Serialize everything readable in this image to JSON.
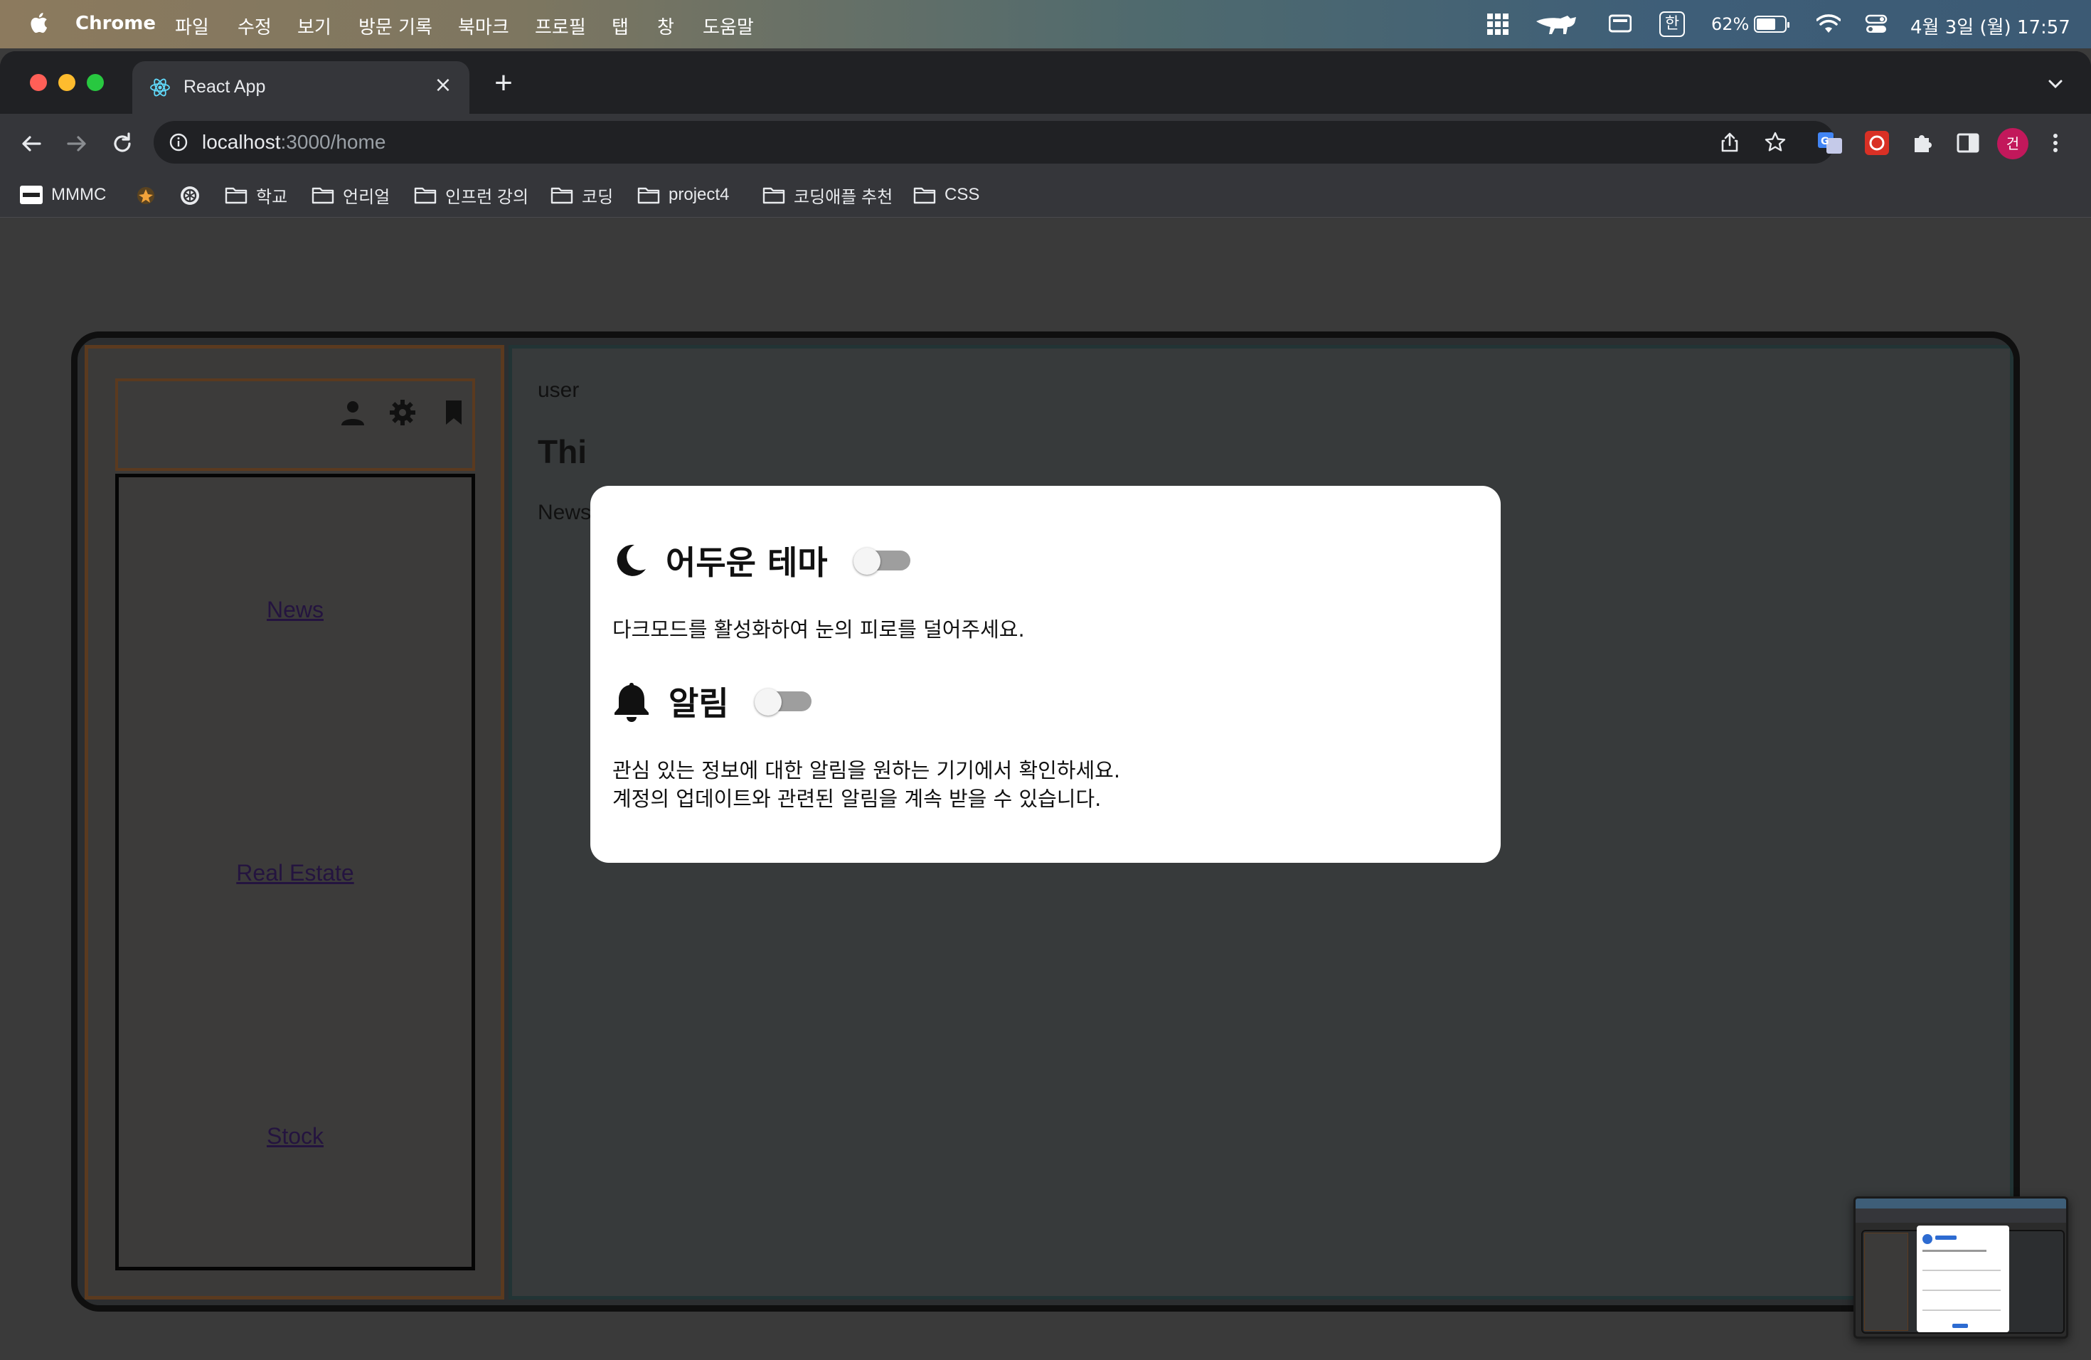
{
  "menubar": {
    "app_name": "Chrome",
    "menus": [
      "파일",
      "수정",
      "보기",
      "방문 기록",
      "북마크",
      "프로필",
      "탭",
      "창",
      "도움말"
    ],
    "input_source": "한",
    "battery_percent": "62%",
    "datetime": "4월 3일 (월) 17:57"
  },
  "browser": {
    "tab_title": "React App",
    "url_host": "localhost",
    "url_path": ":3000/home",
    "profile_initial": "건",
    "bookmarks": [
      "MMMC",
      "학교",
      "언리얼",
      "인프런 강의",
      "코딩",
      "project4",
      "코딩애플 추천",
      "CSS"
    ]
  },
  "app": {
    "sidebar_links": [
      "News",
      "Real Estate",
      "Stock"
    ],
    "main_user": "user",
    "main_heading": "Thi",
    "main_news": "News"
  },
  "modal": {
    "dark_theme": {
      "title": "어두운 테마",
      "description": "다크모드를 활성화하여 눈의 피로를 덜어주세요.",
      "enabled": false
    },
    "notifications": {
      "title": "알림",
      "description_line1": "관심 있는 정보에 대한 알림을 원하는 기기에서 확인하세요.",
      "description_line2": "계정의 업데이트와 관련된 알림을 계속 받을 수 있습니다.",
      "enabled": false
    }
  },
  "colors": {
    "sidebar_border": "#5b3a1f",
    "main_border": "#223435",
    "toggle_track": "#9e9e9e",
    "profile_badge": "#c2185b"
  }
}
